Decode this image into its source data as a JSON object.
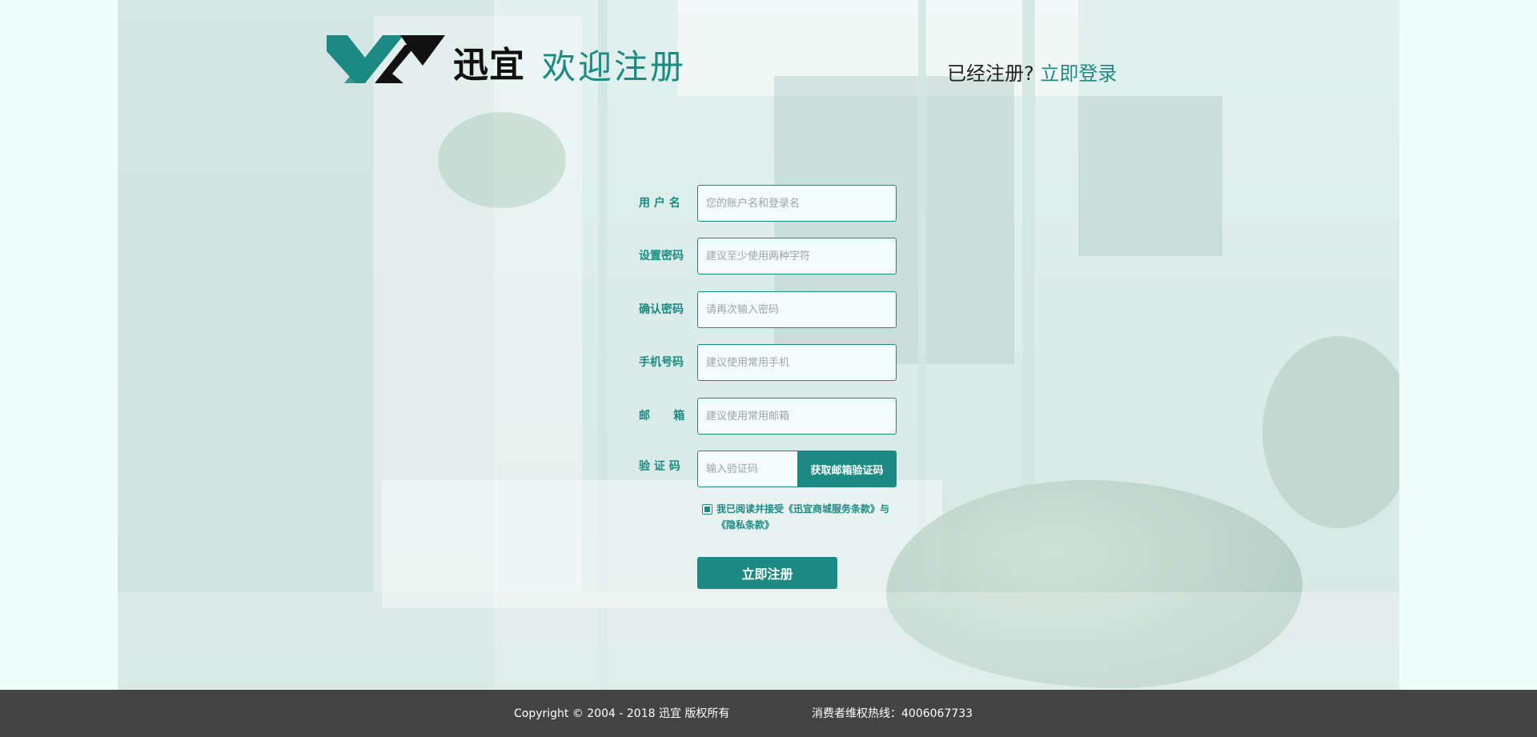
{
  "header": {
    "brand": "迅宜",
    "welcome": "欢迎注册",
    "login_prompt": "已经注册?",
    "login_link": "立即登录"
  },
  "form": {
    "username": {
      "label": "用 户 名",
      "placeholder": "您的账户名和登录名"
    },
    "password": {
      "label": "设置密码",
      "placeholder": "建议至少使用两种字符"
    },
    "confirm": {
      "label": "确认密码",
      "placeholder": "请再次输入密码"
    },
    "phone": {
      "label": "手机号码",
      "placeholder": "建议使用常用手机"
    },
    "email": {
      "label": "邮      箱",
      "placeholder": "建议使用常用邮箱"
    },
    "code": {
      "label": "验 证 码",
      "placeholder": "输入验证码",
      "button": "获取邮箱验证码"
    },
    "agreement": "我已阅读并接受《迅宜商城服务条款》与《隐私条款》",
    "submit": "立即注册"
  },
  "footer": {
    "copyright": "Copyright © 2004 - 2018  迅宜 版权所有",
    "hotline": "消费者维权热线：4006067733"
  },
  "colors": {
    "accent": "#1a8a82",
    "page_bg": "#effefb",
    "footer_bg": "#444444"
  },
  "icons": {
    "logo": "xunyi-chevron-logo",
    "agree_checkbox": "checkbox-checked"
  }
}
